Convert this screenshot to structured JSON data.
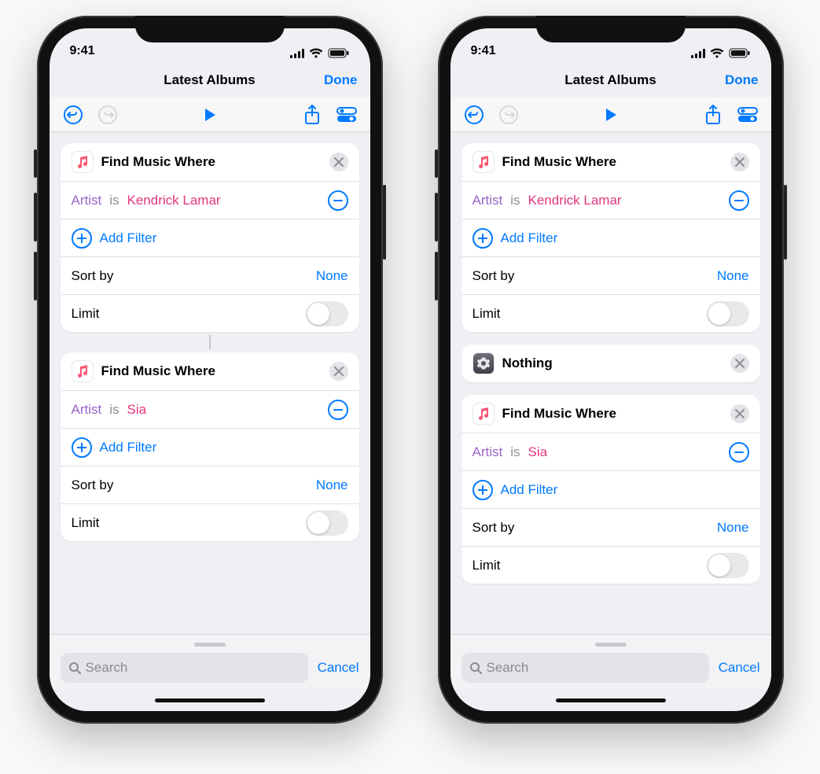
{
  "status": {
    "time": "9:41"
  },
  "nav": {
    "title": "Latest Albums",
    "done": "Done"
  },
  "labels": {
    "add_filter": "Add Filter",
    "sort_by": "Sort by",
    "sort_none": "None",
    "limit": "Limit",
    "search_placeholder": "Search",
    "cancel": "Cancel"
  },
  "blocks": {
    "find_music": "Find Music Where",
    "nothing": "Nothing"
  },
  "filter_tokens": {
    "field": "Artist",
    "op": "is"
  },
  "phone_left": {
    "actions": [
      {
        "artist_value": "Kendrick Lamar"
      },
      {
        "artist_value": "Sia"
      }
    ]
  },
  "phone_right": {
    "actions": [
      {
        "artist_value": "Kendrick Lamar"
      },
      {
        "artist_value": "Sia"
      }
    ]
  }
}
